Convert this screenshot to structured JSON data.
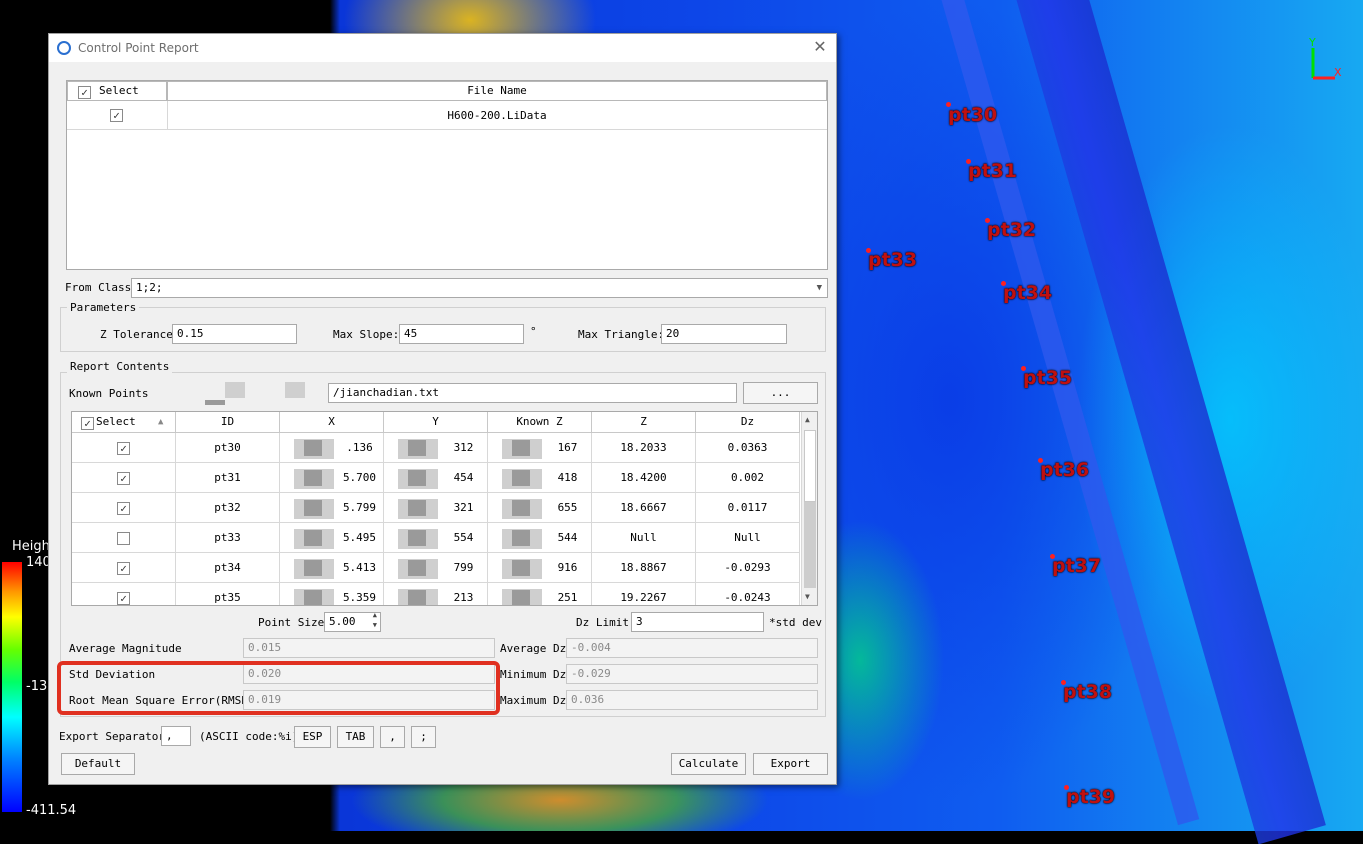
{
  "viewport": {
    "legend": {
      "title": "Heigh",
      "max": "140",
      "mid": "-13",
      "min": "-411.54"
    },
    "control_points": [
      {
        "label": "pt30"
      },
      {
        "label": "pt31"
      },
      {
        "label": "pt32"
      },
      {
        "label": "pt33"
      },
      {
        "label": "pt34"
      },
      {
        "label": "pt35"
      },
      {
        "label": "pt36"
      },
      {
        "label": "pt37"
      },
      {
        "label": "pt38"
      },
      {
        "label": "pt39"
      }
    ],
    "axis": {
      "y": "Y",
      "x": "X"
    }
  },
  "dialog": {
    "title": "Control Point Report",
    "file_table": {
      "headers": {
        "select": "Select",
        "file_name": "File Name"
      },
      "rows": [
        {
          "checked": true,
          "file_name": "H600-200.LiData"
        }
      ]
    },
    "from_class": {
      "label": "From Class:",
      "value": "1;2;"
    },
    "parameters": {
      "title": "Parameters",
      "z_tolerance": {
        "label": "Z Tolerance",
        "value": "0.15"
      },
      "max_slope": {
        "label": "Max Slope:",
        "value": "45",
        "unit": "°"
      },
      "max_triangle": {
        "label": "Max Triangle:",
        "value": "20"
      }
    },
    "report": {
      "title": "Report Contents",
      "known_points": {
        "label": "Known Points",
        "path": "/jianchadian.txt",
        "browse": "..."
      },
      "columns": [
        "Select",
        "ID",
        "X",
        "Y",
        "Known Z",
        "Z",
        "Dz"
      ],
      "rows": [
        {
          "checked": true,
          "id": "pt30",
          "x": ".136",
          "y": "312",
          "kz": "167",
          "z": "18.2033",
          "dz": "0.0363"
        },
        {
          "checked": true,
          "id": "pt31",
          "x": "5.700",
          "y": "454",
          "kz": "418",
          "z": "18.4200",
          "dz": "0.002"
        },
        {
          "checked": true,
          "id": "pt32",
          "x": "5.799",
          "y": "321",
          "kz": "655",
          "z": "18.6667",
          "dz": "0.0117"
        },
        {
          "checked": false,
          "id": "pt33",
          "x": "5.495",
          "y": "554",
          "kz": "544",
          "z": "Null",
          "dz": "Null"
        },
        {
          "checked": true,
          "id": "pt34",
          "x": "5.413",
          "y": "799",
          "kz": "916",
          "z": "18.8867",
          "dz": "-0.0293"
        },
        {
          "checked": true,
          "id": "pt35",
          "x": "5.359",
          "y": "213",
          "kz": "251",
          "z": "19.2267",
          "dz": "-0.0243"
        }
      ],
      "point_size": {
        "label": "Point Size",
        "value": "5.00"
      },
      "dz_limit": {
        "label": "Dz Limit",
        "value": "3",
        "suffix": "*std dev"
      },
      "stats": {
        "avg_magnitude": {
          "label": "Average Magnitude",
          "value": "0.015"
        },
        "std_dev": {
          "label": "Std Deviation",
          "value": "0.020"
        },
        "rmse": {
          "label": "Root Mean Square Error(RMSE)",
          "value": "0.019"
        },
        "avg_dz": {
          "label": "Average Dz",
          "value": "-0.004"
        },
        "min_dz": {
          "label": "Minimum Dz",
          "value": "-0.029"
        },
        "max_dz": {
          "label": "Maximum Dz",
          "value": "0.036"
        }
      }
    },
    "export": {
      "label": "Export Separator",
      "value": ",",
      "ascii_label": "(ASCII code:%i)",
      "buttons": [
        "ESP",
        "TAB",
        ",",
        ";"
      ]
    },
    "buttons": {
      "default": "Default",
      "calculate": "Calculate",
      "export": "Export"
    }
  }
}
